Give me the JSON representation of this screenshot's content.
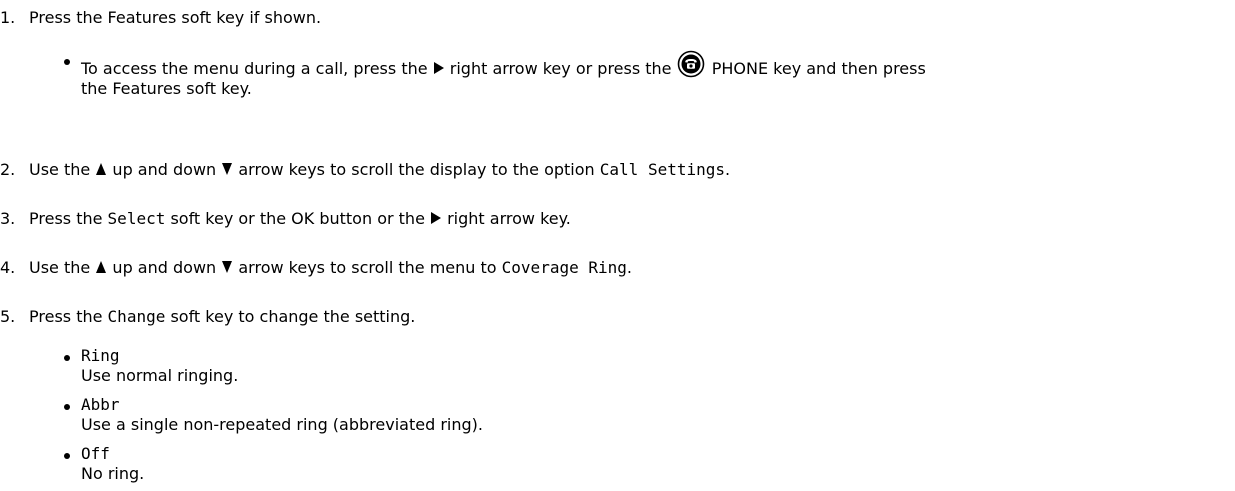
{
  "steps": [
    {
      "number": "1.",
      "text": "Press the Features soft key if shown.",
      "bullets": [
        {
          "part1": "To access the menu during a call, press the",
          "part2": "right arrow key or press the",
          "part3": "PHONE key and then press",
          "part4": "the Features soft key."
        }
      ]
    },
    {
      "number": "2.",
      "part1": "Use the",
      "part2": "up and down",
      "part3": "arrow keys to scroll the display to the option",
      "ui_text": "Call Settings",
      "part4": "."
    },
    {
      "number": "3.",
      "part1": "Press the",
      "ui_text": "Select",
      "part2": "soft key or the OK button or the",
      "part3": "right arrow key."
    },
    {
      "number": "4.",
      "part1": "Use the",
      "part2": "up and down",
      "part3": "arrow keys to scroll the menu to",
      "ui_text": "Coverage Ring",
      "part4": "."
    },
    {
      "number": "5.",
      "part1": "Press the",
      "ui_text": "Change",
      "part2": "soft key to change the setting."
    }
  ],
  "options": [
    {
      "name": "Ring",
      "description": "Use normal ringing."
    },
    {
      "name": "Abbr",
      "description": "Use a single non-repeated ring (abbreviated ring)."
    },
    {
      "name": "Off",
      "description": "No ring."
    }
  ],
  "icons": {
    "right_arrow": "right-arrow-key-icon",
    "up_arrow": "up-arrow-key-icon",
    "down_arrow": "down-arrow-key-icon",
    "phone_key": "phone-key-icon"
  }
}
